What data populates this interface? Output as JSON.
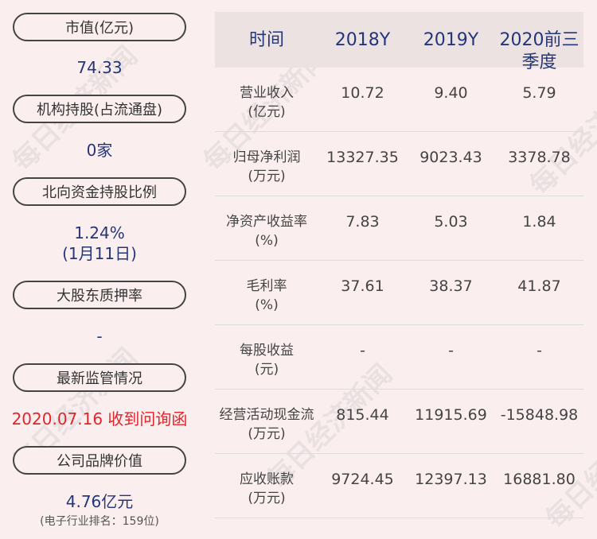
{
  "left": {
    "items": [
      {
        "label": "市值(亿元)",
        "value": "74.33"
      },
      {
        "label": "机构持股(占流通盘)",
        "value": "0家"
      },
      {
        "label": "北向资金持股比例",
        "value": "1.24%",
        "value2": "(1月11日)"
      },
      {
        "label": "大股东质押率",
        "value": "-"
      },
      {
        "label": "最新监管情况",
        "value": "2020.07.16 收到问询函"
      },
      {
        "label": "公司品牌价值",
        "value": "4.76亿元",
        "note": "(电子行业排名：159位)"
      }
    ]
  },
  "table": {
    "headers": [
      "时间",
      "2018Y",
      "2019Y",
      "2020前三季度"
    ],
    "header_last_line1": "2020前三",
    "header_last_line2": "季度",
    "rows": [
      {
        "name1": "营业收入",
        "name2": "(亿元)",
        "v": [
          "10.72",
          "9.40",
          "5.79"
        ]
      },
      {
        "name1": "归母净利润",
        "name2": "(万元)",
        "v": [
          "13327.35",
          "9023.43",
          "3378.78"
        ]
      },
      {
        "name1": "净资产收益率",
        "name2": "(%)",
        "v": [
          "7.83",
          "5.03",
          "1.84"
        ]
      },
      {
        "name1": "毛利率",
        "name2": "(%)",
        "v": [
          "37.61",
          "38.37",
          "41.87"
        ]
      },
      {
        "name1": "每股收益",
        "name2": "(元)",
        "v": [
          "-",
          "-",
          "-"
        ]
      },
      {
        "name1": "经营活动现金流",
        "name2": "(万元)",
        "v": [
          "815.44",
          "11915.69",
          "-15848.98"
        ]
      },
      {
        "name1": "应收账款",
        "name2": "(万元)",
        "v": [
          "9724.45",
          "12397.13",
          "16881.80"
        ]
      }
    ]
  },
  "watermark": "每日经济新闻",
  "colors": {
    "accent": "#24367a",
    "alert": "#e0252b",
    "background": "#fbeeee"
  }
}
